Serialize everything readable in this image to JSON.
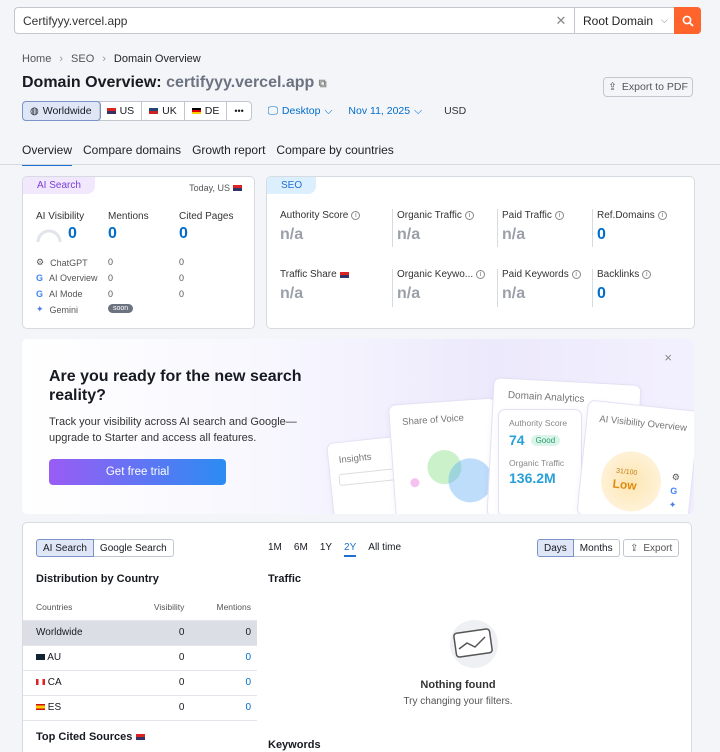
{
  "search": {
    "value": "Certifyyy.vercel.app",
    "scope": "Root Domain"
  },
  "breadcrumb": [
    "Home",
    "SEO",
    "Domain Overview"
  ],
  "title": {
    "prefix": "Domain Overview:",
    "domain": "certifyyy.vercel.app"
  },
  "export_pdf": "Export to PDF",
  "filters": {
    "regions": [
      "Worldwide",
      "US",
      "UK",
      "DE"
    ],
    "more": "•••",
    "device": "Desktop",
    "date": "Nov 11, 2025",
    "currency": "USD"
  },
  "tabs": [
    "Overview",
    "Compare domains",
    "Growth report",
    "Compare by countries"
  ],
  "ai_card": {
    "pill": "AI Search",
    "meta": "Today, US",
    "cols": [
      {
        "label": "AI Visibility",
        "value": "0"
      },
      {
        "label": "Mentions",
        "value": "0"
      },
      {
        "label": "Cited Pages",
        "value": "0"
      }
    ],
    "rows": [
      {
        "name": "ChatGPT",
        "mentions": "0",
        "cited": "0"
      },
      {
        "name": "AI Overview",
        "mentions": "0",
        "cited": "0"
      },
      {
        "name": "AI Mode",
        "mentions": "0",
        "cited": "0"
      },
      {
        "name": "Gemini",
        "badge": "soon"
      }
    ]
  },
  "seo_card": {
    "pill": "SEO",
    "row1": [
      {
        "label": "Authority Score",
        "value": "n/a"
      },
      {
        "label": "Organic Traffic",
        "value": "n/a"
      },
      {
        "label": "Paid Traffic",
        "value": "n/a"
      },
      {
        "label": "Ref.Domains",
        "value": "0"
      }
    ],
    "row2": [
      {
        "label": "Traffic Share",
        "value": "n/a"
      },
      {
        "label": "Organic Keywo...",
        "value": "n/a"
      },
      {
        "label": "Paid Keywords",
        "value": "n/a"
      },
      {
        "label": "Backlinks",
        "value": "0"
      }
    ]
  },
  "banner": {
    "heading": "Are you ready for the new search reality?",
    "text": "Track your visibility across AI search and Google—upgrade to Starter and access all features.",
    "cta": "Get free trial",
    "close": "×",
    "cards": {
      "insights": "Insights",
      "share": "Share of Voice",
      "domain": "Domain Analytics",
      "authority": "Authority Score",
      "auth_val": "74",
      "auth_badge": "Good",
      "organic": "Organic Traffic",
      "organic_val": "136.2M",
      "ai_vis": "AI Visibility Overview",
      "gauge_val": "31/100",
      "gauge_label": "Low"
    }
  },
  "bottom": {
    "toggle": [
      "AI Search",
      "Google Search"
    ],
    "periods": [
      "1M",
      "6M",
      "1Y",
      "2Y",
      "All time"
    ],
    "units": [
      "Days",
      "Months"
    ],
    "export": "Export",
    "dist_title": "Distribution by Country",
    "dist_headers": [
      "Countries",
      "Visibility",
      "Mentions"
    ],
    "dist_rows": [
      {
        "country": "Worldwide",
        "vis": "0",
        "men": "0"
      },
      {
        "country": "AU",
        "vis": "0",
        "men": "0"
      },
      {
        "country": "CA",
        "vis": "0",
        "men": "0"
      },
      {
        "country": "ES",
        "vis": "0",
        "men": "0"
      }
    ],
    "traffic": "Traffic",
    "nothing": "Nothing found",
    "nothing_sub": "Try changing your filters.",
    "cited_title": "Top Cited Sources",
    "keywords": "Keywords"
  }
}
